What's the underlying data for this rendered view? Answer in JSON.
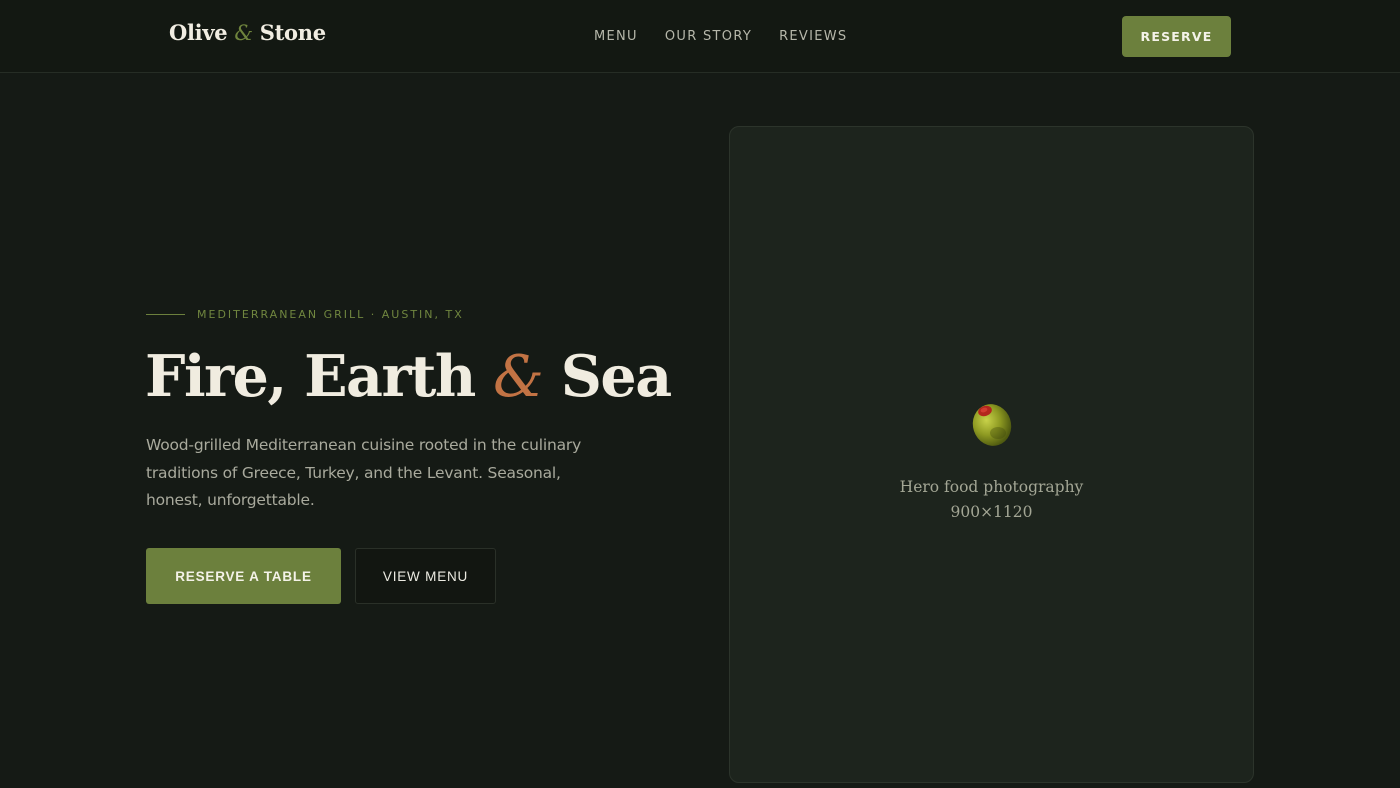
{
  "brand": {
    "name_left": "Olive",
    "name_amp": "&",
    "name_right": "Stone",
    "accent_color": "#6c803d",
    "highlight_color": "#c27344"
  },
  "nav": {
    "items": [
      {
        "label": "MENU"
      },
      {
        "label": "OUR STORY"
      },
      {
        "label": "REVIEWS"
      }
    ],
    "reserve_label": "RESERVE"
  },
  "hero": {
    "eyebrow": "MEDITERRANEAN GRILL · AUSTIN, TX",
    "headline_part1": "Fire, Earth",
    "headline_amp": "&",
    "headline_part2": "Sea",
    "lede": "Wood-grilled Mediterranean cuisine rooted in the culinary traditions of Greece, Turkey, and the Levant. Seasonal, honest, unforgettable.",
    "primary_cta": "RESERVE A TABLE",
    "secondary_cta": "VIEW MENU"
  },
  "media": {
    "icon": "olive-icon",
    "caption_line1": "Hero food photography",
    "caption_line2": "900×1120"
  }
}
